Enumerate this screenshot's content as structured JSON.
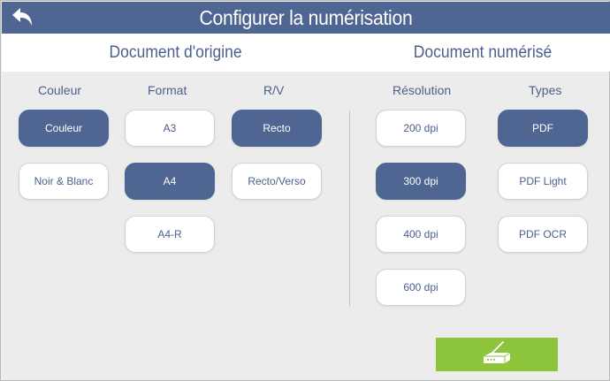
{
  "header": {
    "title": "Configurer la numérisation",
    "back_icon": "back-arrow-icon"
  },
  "sections": {
    "origin_title": "Document d'origine",
    "scanned_title": "Document numérisé"
  },
  "columns": {
    "couleur": {
      "label": "Couleur",
      "options": [
        "Couleur",
        "Noir & Blanc"
      ],
      "selected": "Couleur"
    },
    "format": {
      "label": "Format",
      "options": [
        "A3",
        "A4",
        "A4-R"
      ],
      "selected": "A4"
    },
    "rv": {
      "label": "R/V",
      "options": [
        "Recto",
        "Recto/Verso"
      ],
      "selected": "Recto"
    },
    "resolution": {
      "label": "Résolution",
      "options": [
        "200 dpi",
        "300 dpi",
        "400 dpi",
        "600 dpi"
      ],
      "selected": "300 dpi"
    },
    "types": {
      "label": "Types",
      "options": [
        "PDF",
        "PDF Light",
        "PDF OCR"
      ],
      "selected": "PDF"
    }
  },
  "scan_button": {
    "icon": "scanner-icon"
  },
  "colors": {
    "primary": "#4f6592",
    "text": "#4a5f8c",
    "scan_green": "#8cc43b",
    "background": "#ececec"
  }
}
